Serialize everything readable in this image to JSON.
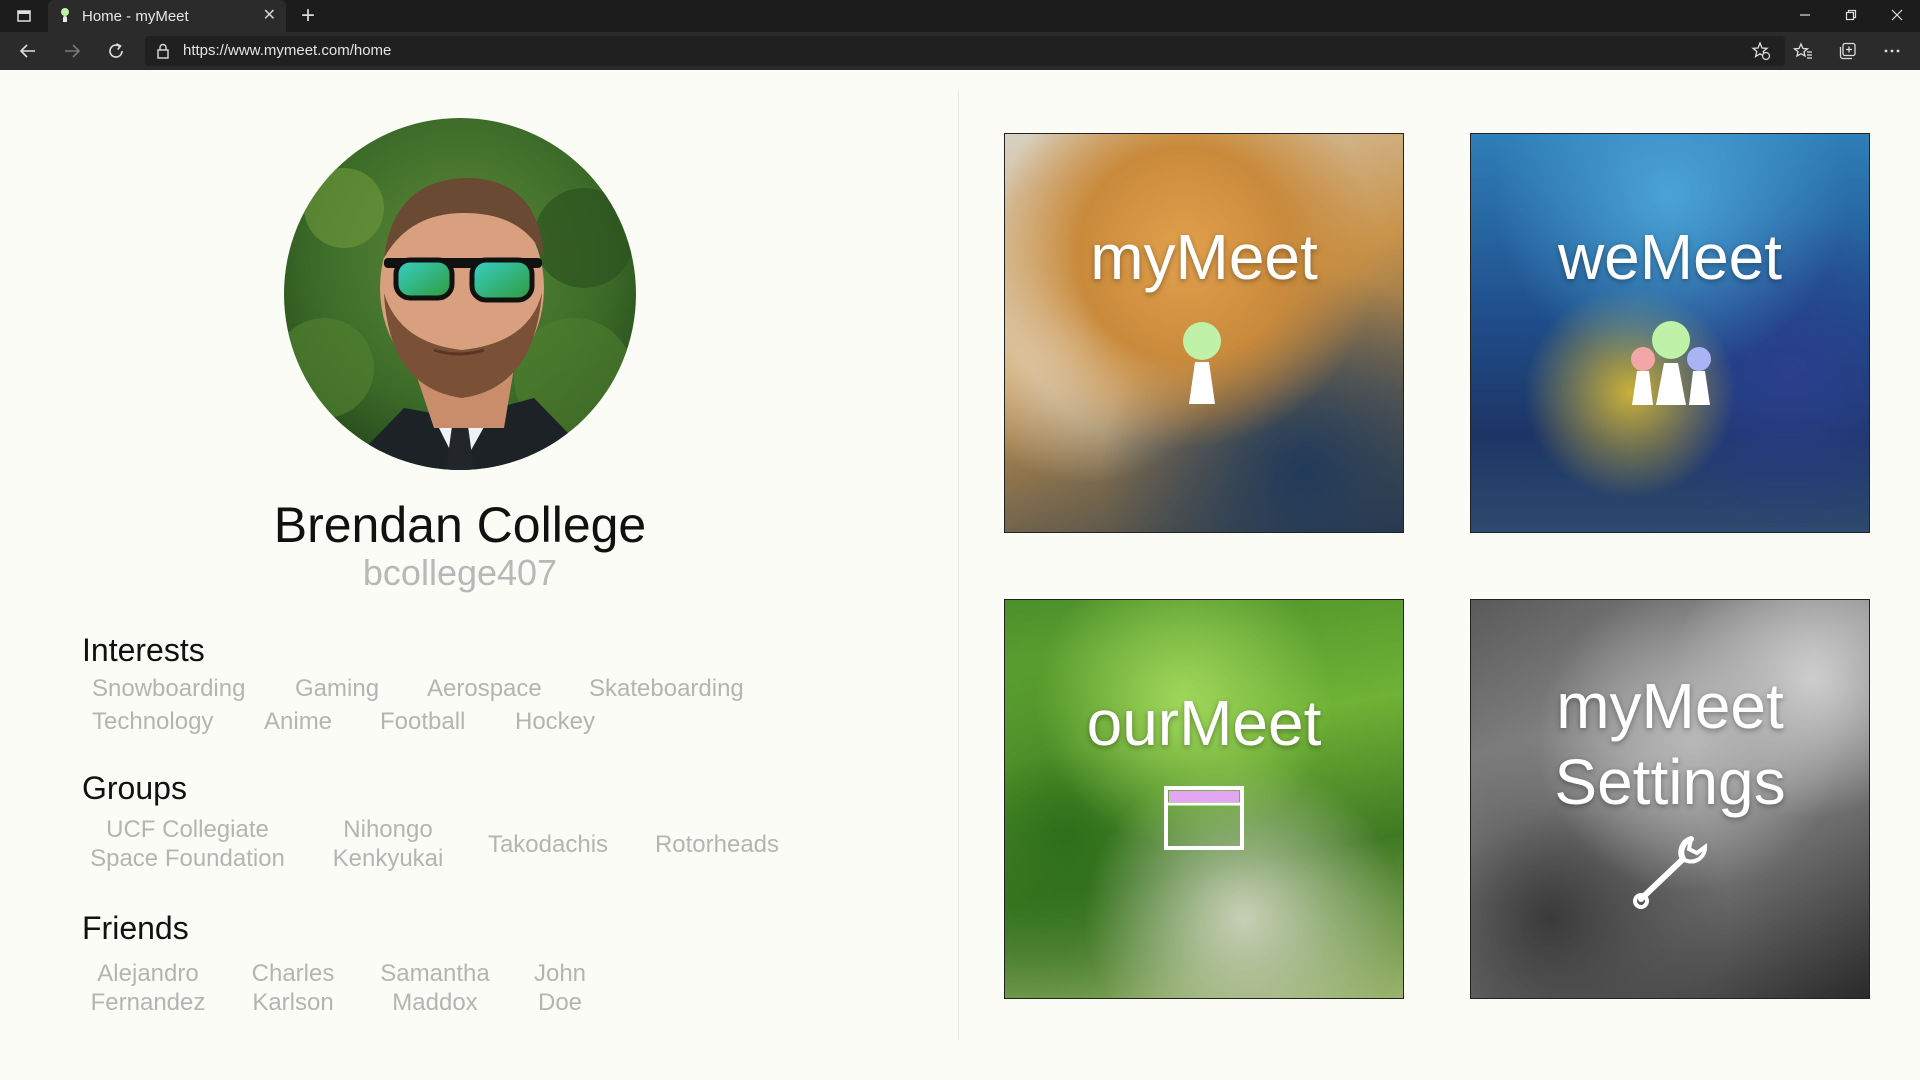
{
  "browser": {
    "tab_title": "Home - myMeet",
    "url": "https://www.mymeet.com/home"
  },
  "profile": {
    "name": "Brendan College",
    "username": "bcollege407"
  },
  "interests": {
    "title": "Interests",
    "items": [
      "Snowboarding",
      "Gaming",
      "Aerospace",
      "Skateboarding",
      "Technology",
      "Anime",
      "Football",
      "Hockey"
    ]
  },
  "groups": {
    "title": "Groups",
    "items": [
      {
        "line1": "UCF Collegiate",
        "line2": "Space Foundation"
      },
      {
        "line1": "Nihongo",
        "line2": "Kenkyukai"
      },
      {
        "line1": "Takodachis",
        "line2": ""
      },
      {
        "line1": "Rotorheads",
        "line2": ""
      }
    ]
  },
  "friends": {
    "title": "Friends",
    "items": [
      {
        "line1": "Alejandro",
        "line2": "Fernandez"
      },
      {
        "line1": "Charles",
        "line2": "Karlson"
      },
      {
        "line1": "Samantha",
        "line2": "Maddox"
      },
      {
        "line1": "John",
        "line2": "Doe"
      }
    ]
  },
  "tiles": {
    "mymeet": {
      "label": "myMeet",
      "icon": "person-icon"
    },
    "wemeet": {
      "label": "weMeet",
      "icon": "group-icon"
    },
    "ourmeet": {
      "label": "ourMeet",
      "icon": "window-icon"
    },
    "settings": {
      "line1": "myMeet",
      "line2": "Settings",
      "icon": "wrench-icon"
    }
  },
  "colors": {
    "person_green": "#bff1a6",
    "group_red": "#f3a6a6",
    "group_blue": "#a8b4f3",
    "window_bar": "#e2a6f3"
  }
}
